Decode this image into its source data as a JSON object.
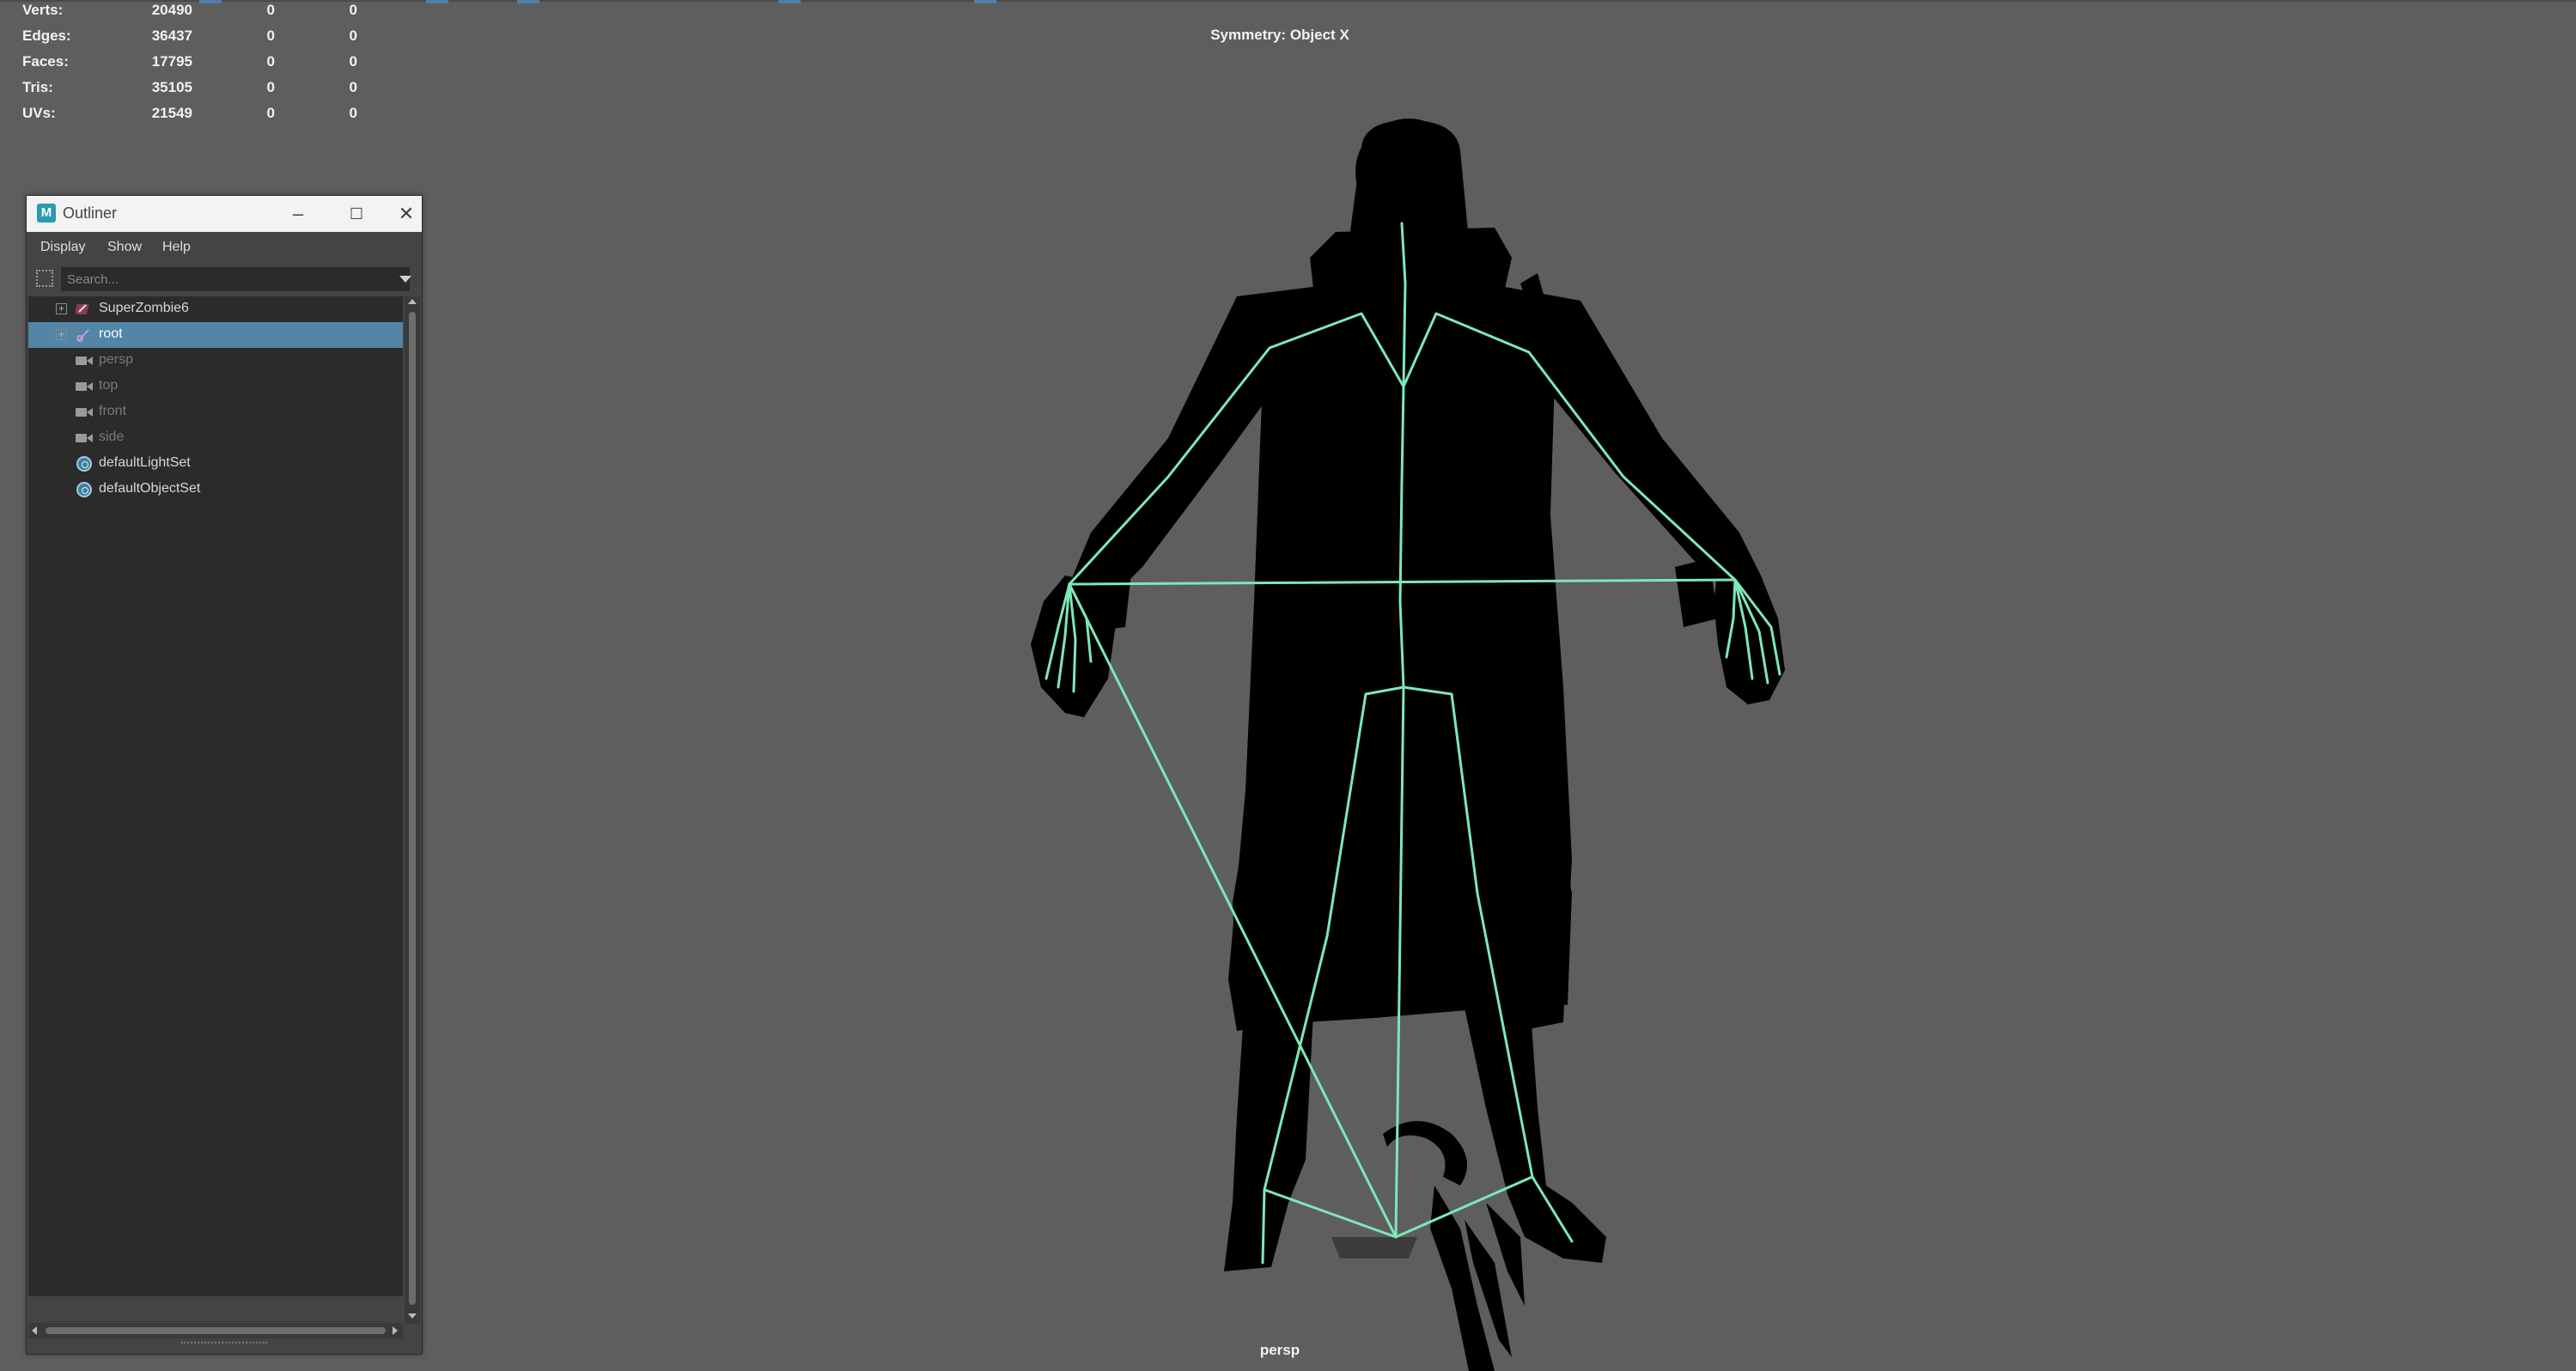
{
  "hud": {
    "rows": [
      {
        "label": "Verts:",
        "v1": "20490",
        "v2": "0",
        "v3": "0"
      },
      {
        "label": "Edges:",
        "v1": "36437",
        "v2": "0",
        "v3": "0"
      },
      {
        "label": "Faces:",
        "v1": "17795",
        "v2": "0",
        "v3": "0"
      },
      {
        "label": "Tris:",
        "v1": "35105",
        "v2": "0",
        "v3": "0"
      },
      {
        "label": "UVs:",
        "v1": "21549",
        "v2": "0",
        "v3": "0"
      }
    ]
  },
  "viewport": {
    "symmetry": "Symmetry: Object X",
    "camera": "persp",
    "background_color": "#5e5e5e",
    "joint_color": "#7de8b8"
  },
  "outliner": {
    "title": "Outliner",
    "logo": "M",
    "window_buttons": {
      "minimize": "–",
      "maximize": "☐",
      "close": "✕"
    },
    "menu": [
      "Display",
      "Show",
      "Help"
    ],
    "search_placeholder": "Search...",
    "items": [
      {
        "label": "SuperZombie6",
        "icon": "mesh-group-icon",
        "expandable": true,
        "selected": false,
        "dim": false
      },
      {
        "label": "root",
        "icon": "joint-icon",
        "expandable": true,
        "selected": true,
        "dim": false
      },
      {
        "label": "persp",
        "icon": "camera-icon",
        "expandable": false,
        "selected": false,
        "dim": true
      },
      {
        "label": "top",
        "icon": "camera-icon",
        "expandable": false,
        "selected": false,
        "dim": true
      },
      {
        "label": "front",
        "icon": "camera-icon",
        "expandable": false,
        "selected": false,
        "dim": true
      },
      {
        "label": "side",
        "icon": "camera-icon",
        "expandable": false,
        "selected": false,
        "dim": true
      },
      {
        "label": "defaultLightSet",
        "icon": "set-icon",
        "expandable": false,
        "selected": false,
        "dim": false
      },
      {
        "label": "defaultObjectSet",
        "icon": "set-icon",
        "expandable": false,
        "selected": false,
        "dim": false
      }
    ]
  }
}
